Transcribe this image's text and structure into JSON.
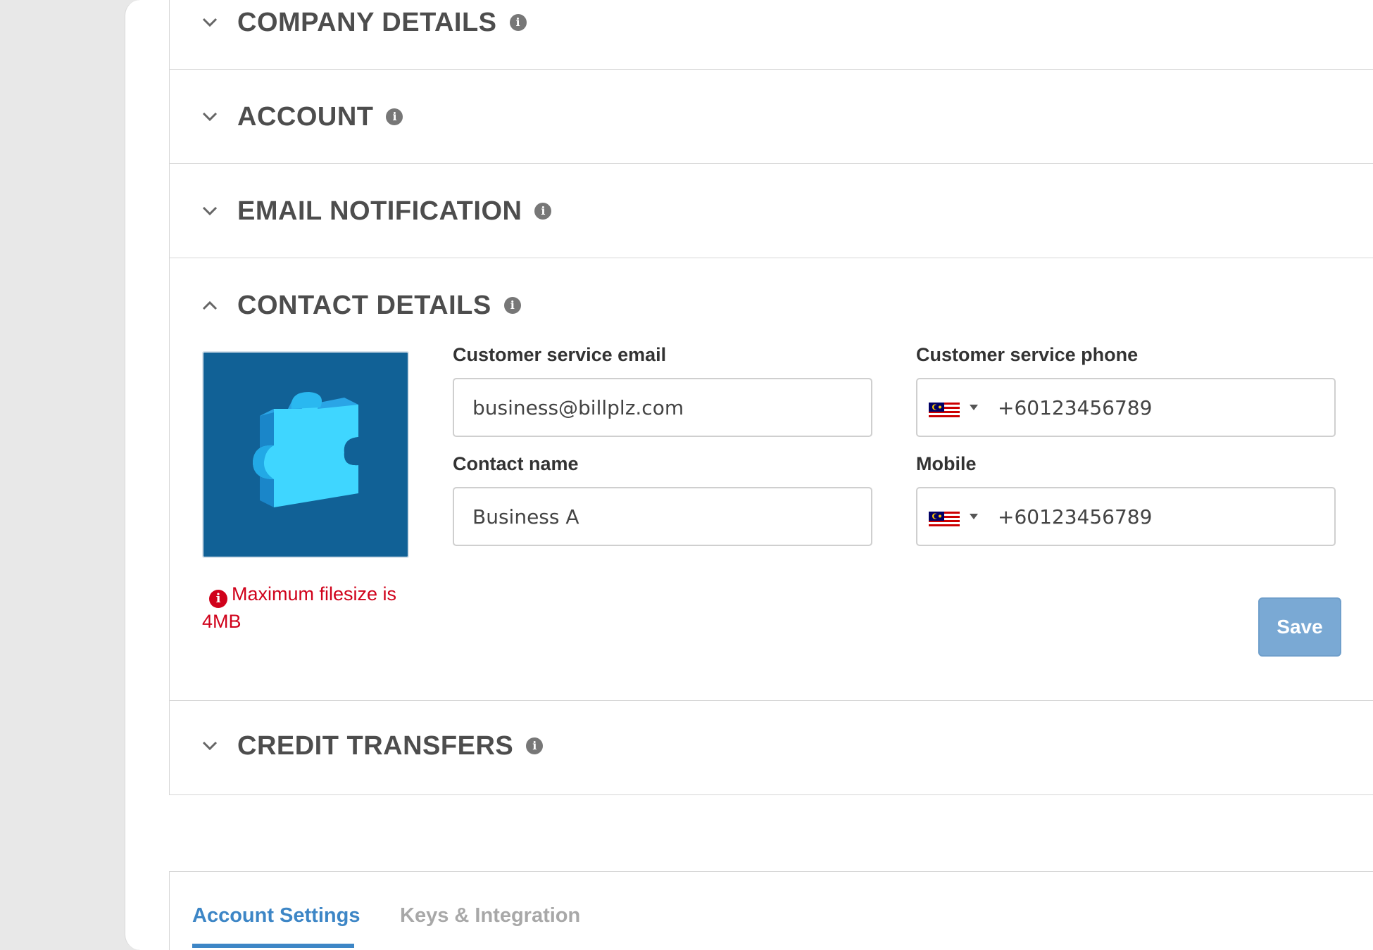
{
  "sections": [
    {
      "title": "COMPANY DETAILS",
      "expanded": false
    },
    {
      "title": "ACCOUNT",
      "expanded": false
    },
    {
      "title": "EMAIL NOTIFICATION",
      "expanded": false
    },
    {
      "title": "CONTACT DETAILS",
      "expanded": true
    },
    {
      "title": "CREDIT TRANSFERS",
      "expanded": false
    }
  ],
  "contact": {
    "logo_icon": "puzzle-piece-icon",
    "filesize_note": "Maximum filesize is 4MB",
    "cs_email_label": "Customer service email",
    "cs_email_value": "business@billplz.com",
    "cs_phone_label": "Customer service phone",
    "cs_phone_value": "+60123456789",
    "contact_name_label": "Contact name",
    "contact_name_value": "Business A",
    "mobile_label": "Mobile",
    "mobile_value": "+60123456789",
    "country_flag": "malaysia-flag-icon",
    "save_label": "Save"
  },
  "tabs": [
    {
      "label": "Account Settings",
      "active": true
    },
    {
      "label": "Keys & Integration",
      "active": false
    }
  ],
  "colors": {
    "accent": "#3d86c6",
    "save_button": "#7aa9d4",
    "error": "#d0021b",
    "logo_bg": "#116196"
  }
}
